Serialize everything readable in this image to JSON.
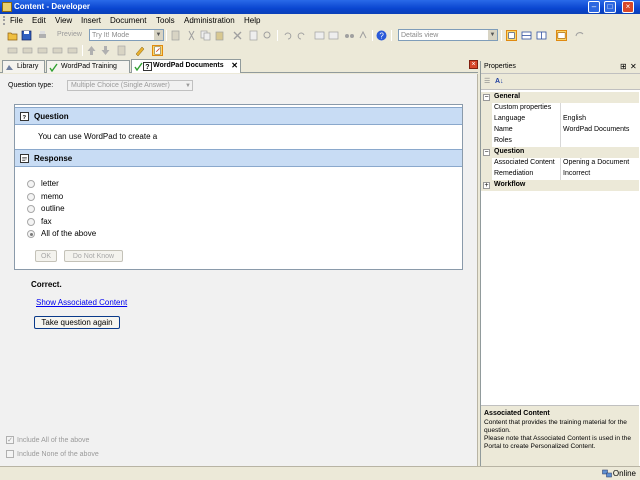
{
  "window": {
    "title": "Content - Developer"
  },
  "menu": [
    "File",
    "Edit",
    "View",
    "Insert",
    "Document",
    "Tools",
    "Administration",
    "Help"
  ],
  "toolbar": {
    "preview_label": "Preview",
    "mode_value": "Try It! Mode",
    "view_value": "Details view"
  },
  "tabs": [
    {
      "label": "Library"
    },
    {
      "label": "WordPad Training"
    },
    {
      "label": "WordPad Documents"
    }
  ],
  "question": {
    "type_label": "Question type:",
    "type_value": "Multiple Choice (Single Answer)",
    "header": "Question",
    "text": "You can use WordPad to create a",
    "response_header": "Response",
    "options": [
      "letter",
      "memo",
      "outline",
      "fax",
      "All of the above"
    ],
    "selected_index": 4,
    "ok_label": "OK",
    "dnk_label": "Do Not Know",
    "feedback": "Correct.",
    "show_link": "Show Associated Content",
    "retake_label": "Take question again",
    "include_all": "Include All of the above",
    "include_none": "Include None of the above"
  },
  "properties": {
    "title": "Properties",
    "categories": [
      {
        "name": "General",
        "expanded": true,
        "rows": [
          {
            "name": "Custom properties",
            "value": ""
          },
          {
            "name": "Language",
            "value": "English"
          },
          {
            "name": "Name",
            "value": "WordPad Documents"
          },
          {
            "name": "Roles",
            "value": ""
          }
        ]
      },
      {
        "name": "Question",
        "expanded": true,
        "rows": [
          {
            "name": "Associated Content",
            "value": "Opening a Document"
          },
          {
            "name": "Remediation",
            "value": "Incorrect"
          }
        ]
      },
      {
        "name": "Workflow",
        "expanded": false,
        "rows": []
      }
    ],
    "desc_title": "Associated Content",
    "desc_text": "Content that provides the training material for the question.\nPlease note that Associated Content is used in the Portal to create Personalized Content."
  },
  "status": {
    "online": "Online"
  },
  "colors": {
    "title_bar": "#0a46d0",
    "section_header": "#c8dcf4",
    "link": "#0000ee"
  }
}
